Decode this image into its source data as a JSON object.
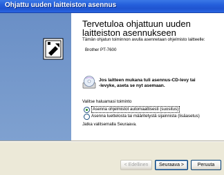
{
  "window": {
    "title": "Ohjattu uuden laitteiston asennus"
  },
  "wizard": {
    "heading": "Tervetuloa ohjattuun uuden laitteiston asennukseen",
    "intro": "Tämän ohjatun toiminnon avulla asennetaan ohjelmisto laitteelle:",
    "device": "Brother PT-7600",
    "cd_hint_line1": "Jos laitteen mukana tuli asennus-CD-levy tai",
    "cd_hint_line2": "-levyke, aseta se nyt asemaan.",
    "choose_action": "Valitse haluamasi toiminto",
    "options": [
      {
        "label": "Asenna ohjelmistot automaattisesti (suositus)",
        "selected": true
      },
      {
        "label": "Asenna luettelosta tai määritetystä sijainnista (lisäasetus)",
        "selected": false
      }
    ],
    "continue_text": "Jatka valitsemalla Seuraava."
  },
  "buttons": {
    "back": "< Edellinen",
    "next": "Seuraava >",
    "cancel": "Peruuta"
  },
  "icons": {
    "wizard": "hardware-wizard-icon",
    "cd": "cd-disc-icon"
  }
}
